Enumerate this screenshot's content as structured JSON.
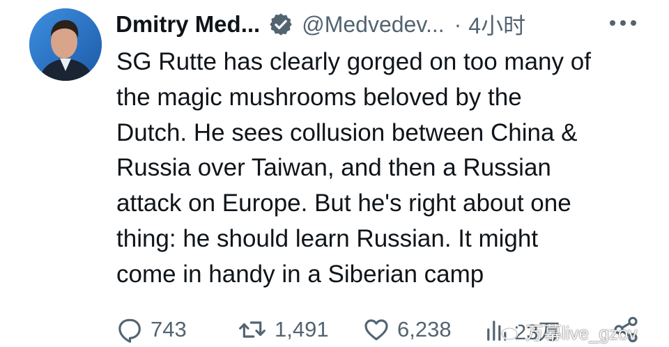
{
  "author": {
    "name": "Dmitry Med...",
    "handle": "@Medvedev...",
    "separator": "·",
    "time": "4小时",
    "verified_color": "#536471"
  },
  "tweet": {
    "lines": [
      "SG Rutte has clearly gorged on too many of",
      "the magic mushrooms beloved by the",
      "Dutch. He sees collusion between China &",
      "Russia over Taiwan, and then a Russian",
      "attack on Europe. But he's right about one",
      "thing: he should learn Russian. It might",
      "come in handy in a Siberian camp"
    ]
  },
  "actions": {
    "replies": "743",
    "reposts": "1,491",
    "likes": "6,238",
    "views": "23万",
    "icon_color": "#536471"
  },
  "watermark": {
    "text": "万幕live_gzov"
  },
  "icons": [
    "avatar",
    "verified-icon",
    "more-icon",
    "reply-icon",
    "repost-icon",
    "like-icon",
    "views-icon",
    "share-icon"
  ]
}
